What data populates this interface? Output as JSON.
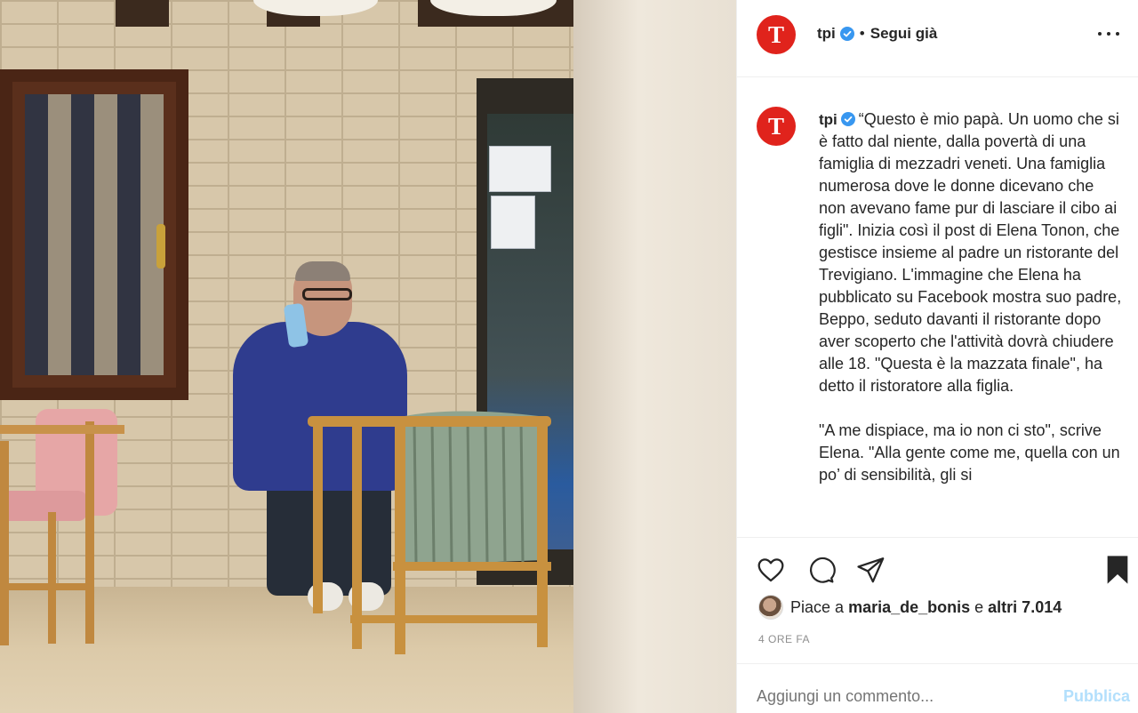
{
  "post": {
    "photo_alt": "",
    "header": {
      "username": "tpi",
      "avatar_letter": "T",
      "dot": "•",
      "follow_label": "Segui già",
      "more_icon": "ellipsis-icon"
    },
    "caption": {
      "username": "tpi",
      "avatar_letter": "T",
      "paragraph_1": "“Questo è mio papà. Un uomo che si è fatto dal niente, dalla povertà di una famiglia di mezzadri veneti. Una famiglia numerosa dove le donne dicevano che non avevano fame pur di lasciare il cibo ai figli\". Inizia così il post di Elena Tonon, che gestisce insieme al padre un ristorante del Trevigiano. L'immagine che Elena ha pubblicato su Facebook mostra suo padre, Beppo, seduto davanti il ristorante dopo aver scoperto che l'attività dovrà chiudere alle 18. \"Questa è la mazzata finale\", ha detto il ristoratore alla figlia.",
      "paragraph_2": "\"A me dispiace, ma io non ci sto\", scrive Elena. \"Alla gente come me, quella con un po’ di sensibilità, gli si"
    },
    "actions": {
      "like_icon": "heart-icon",
      "comment_icon": "comment-icon",
      "share_icon": "paper-plane-icon",
      "save_icon": "bookmark-icon"
    },
    "likes": {
      "prefix": "Piace a",
      "user": "maria_de_bonis",
      "middle": "e",
      "others": "altri 7.014"
    },
    "timestamp": "4 ORE FA",
    "comment": {
      "placeholder": "Aggiungi un commento...",
      "publish_label": "Pubblica"
    },
    "colors": {
      "brand_red": "#e0231c",
      "verified_blue": "#3897f0",
      "publish_disabled": "#b2dffc"
    }
  }
}
